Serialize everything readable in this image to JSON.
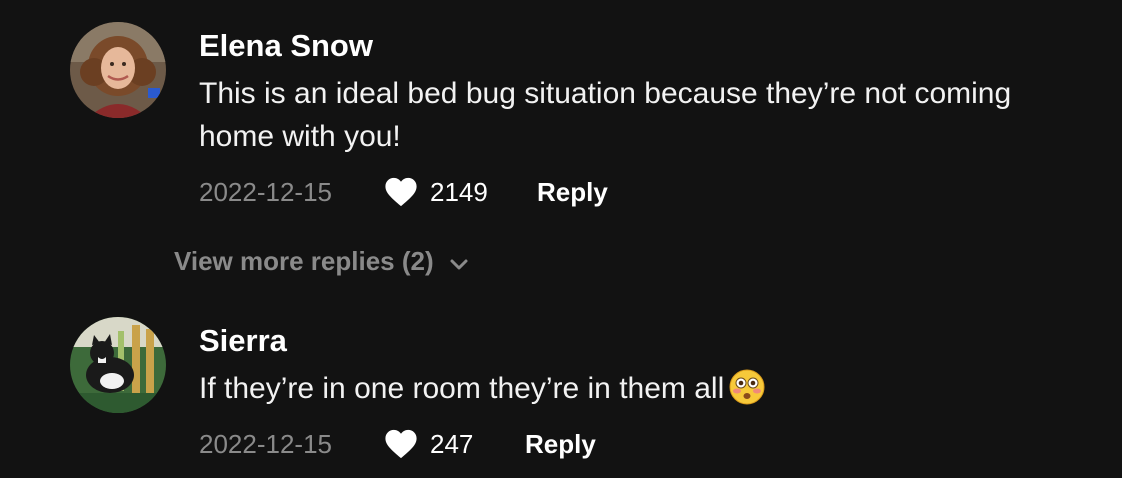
{
  "comments": [
    {
      "author": "Elena Snow",
      "text": "This is an ideal bed bug situation because they’re not coming home with you!",
      "date": "2022-12-15",
      "likes": "2149",
      "reply_label": "Reply",
      "avatar_icon": "avatar-woman-curly-hair"
    },
    {
      "author": "Sierra",
      "text": "If they’re in one room they’re in them all",
      "emoji": "flushed-face-emoji",
      "date": "2022-12-15",
      "likes": "247",
      "reply_label": "Reply",
      "avatar_icon": "avatar-cat-on-chair"
    }
  ],
  "view_more_replies": {
    "label": "View more replies (2)",
    "icon": "chevron-down-icon"
  },
  "colors": {
    "background": "#121212",
    "primary_text": "#ffffff",
    "secondary_text": "#8a8a8a"
  }
}
